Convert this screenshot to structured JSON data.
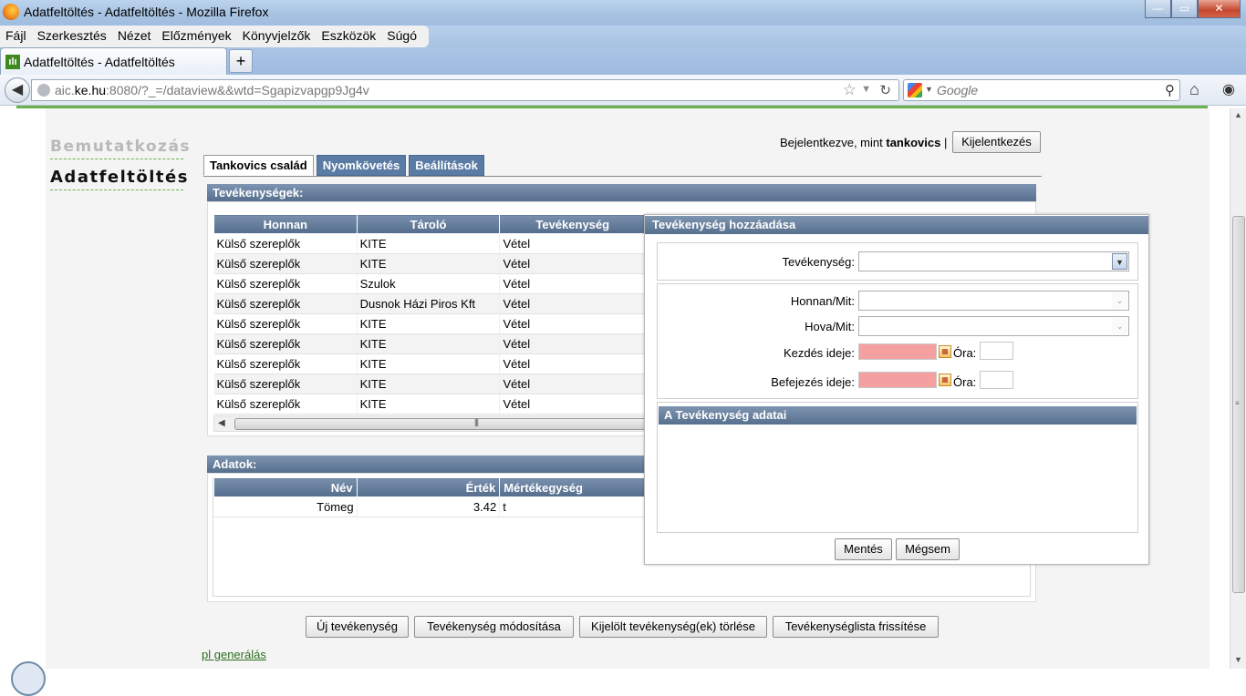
{
  "window": {
    "title": "Adatfeltöltés - Adatfeltöltés - Mozilla Firefox",
    "controls": {
      "minimize": "—",
      "maximize": "▭",
      "close": "✕"
    }
  },
  "menubar": [
    "Fájl",
    "Szerkesztés",
    "Nézet",
    "Előzmények",
    "Könyvjelzők",
    "Eszközök",
    "Súgó"
  ],
  "browser_tab": {
    "label": "Adatfeltöltés - Adatfeltöltés",
    "new_tab": "+"
  },
  "address": {
    "prefix": "aic.",
    "domain": "ke.hu",
    "rest": ":8080/?_=/dataview&&wtd=Sgapizvapgp9Jg4v"
  },
  "search": {
    "placeholder": "Google"
  },
  "sidenav": {
    "item1": "Bemutatkozás",
    "item2": "Adatfeltöltés"
  },
  "login": {
    "prefix": "Bejelentkezve, mint",
    "user": "tankovics",
    "sep": "|",
    "logout": "Kijelentkezés"
  },
  "tabs": [
    "Tankovics család",
    "Nyomkövetés",
    "Beállítások"
  ],
  "activities": {
    "header": "Tevékenységek:",
    "columns": [
      "Honnan",
      "Tároló",
      "Tevékenység"
    ],
    "rows": [
      [
        "Külső szereplők",
        "KITE",
        "Vétel"
      ],
      [
        "Külső szereplők",
        "KITE",
        "Vétel"
      ],
      [
        "Külső szereplők",
        "Szulok",
        "Vétel"
      ],
      [
        "Külső szereplők",
        "Dusnok Házi Piros Kft",
        "Vétel"
      ],
      [
        "Külső szereplők",
        "KITE",
        "Vétel"
      ],
      [
        "Külső szereplők",
        "KITE",
        "Vétel"
      ],
      [
        "Külső szereplők",
        "KITE",
        "Vétel"
      ],
      [
        "Külső szereplők",
        "KITE",
        "Vétel"
      ],
      [
        "Külső szereplők",
        "KITE",
        "Vétel"
      ]
    ]
  },
  "data_section": {
    "header": "Adatok:",
    "columns": [
      "Név",
      "Érték",
      "Mértékegység"
    ],
    "rows": [
      [
        "Tömeg",
        "3.42",
        "t"
      ]
    ]
  },
  "bottom_buttons": [
    "Új tevékenység",
    "Tevékenység módosítása",
    "Kijelölt tevékenység(ek) törlése",
    "Tevékenységlista frissítése"
  ],
  "footer_link": "pl generálás",
  "dialog": {
    "title": "Tevékenység hozzáadása",
    "activity_label": "Tevékenység:",
    "from_label": "Honnan/Mit:",
    "to_label": "Hova/Mit:",
    "start_label": "Kezdés ideje:",
    "end_label": "Befejezés ideje:",
    "hour_label": "Óra:",
    "details_header": "A Tevékenység adatai",
    "save": "Mentés",
    "cancel": "Mégsem"
  }
}
